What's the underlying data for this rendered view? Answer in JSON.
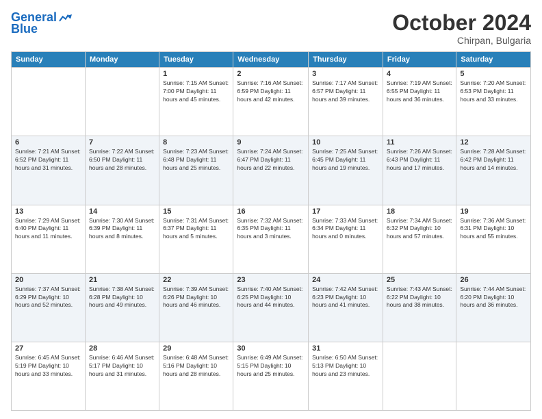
{
  "header": {
    "logo_line1": "General",
    "logo_line2": "Blue",
    "month": "October 2024",
    "location": "Chirpan, Bulgaria"
  },
  "weekdays": [
    "Sunday",
    "Monday",
    "Tuesday",
    "Wednesday",
    "Thursday",
    "Friday",
    "Saturday"
  ],
  "weeks": [
    [
      {
        "day": "",
        "info": ""
      },
      {
        "day": "",
        "info": ""
      },
      {
        "day": "1",
        "info": "Sunrise: 7:15 AM\nSunset: 7:00 PM\nDaylight: 11 hours and 45 minutes."
      },
      {
        "day": "2",
        "info": "Sunrise: 7:16 AM\nSunset: 6:59 PM\nDaylight: 11 hours and 42 minutes."
      },
      {
        "day": "3",
        "info": "Sunrise: 7:17 AM\nSunset: 6:57 PM\nDaylight: 11 hours and 39 minutes."
      },
      {
        "day": "4",
        "info": "Sunrise: 7:19 AM\nSunset: 6:55 PM\nDaylight: 11 hours and 36 minutes."
      },
      {
        "day": "5",
        "info": "Sunrise: 7:20 AM\nSunset: 6:53 PM\nDaylight: 11 hours and 33 minutes."
      }
    ],
    [
      {
        "day": "6",
        "info": "Sunrise: 7:21 AM\nSunset: 6:52 PM\nDaylight: 11 hours and 31 minutes."
      },
      {
        "day": "7",
        "info": "Sunrise: 7:22 AM\nSunset: 6:50 PM\nDaylight: 11 hours and 28 minutes."
      },
      {
        "day": "8",
        "info": "Sunrise: 7:23 AM\nSunset: 6:48 PM\nDaylight: 11 hours and 25 minutes."
      },
      {
        "day": "9",
        "info": "Sunrise: 7:24 AM\nSunset: 6:47 PM\nDaylight: 11 hours and 22 minutes."
      },
      {
        "day": "10",
        "info": "Sunrise: 7:25 AM\nSunset: 6:45 PM\nDaylight: 11 hours and 19 minutes."
      },
      {
        "day": "11",
        "info": "Sunrise: 7:26 AM\nSunset: 6:43 PM\nDaylight: 11 hours and 17 minutes."
      },
      {
        "day": "12",
        "info": "Sunrise: 7:28 AM\nSunset: 6:42 PM\nDaylight: 11 hours and 14 minutes."
      }
    ],
    [
      {
        "day": "13",
        "info": "Sunrise: 7:29 AM\nSunset: 6:40 PM\nDaylight: 11 hours and 11 minutes."
      },
      {
        "day": "14",
        "info": "Sunrise: 7:30 AM\nSunset: 6:39 PM\nDaylight: 11 hours and 8 minutes."
      },
      {
        "day": "15",
        "info": "Sunrise: 7:31 AM\nSunset: 6:37 PM\nDaylight: 11 hours and 5 minutes."
      },
      {
        "day": "16",
        "info": "Sunrise: 7:32 AM\nSunset: 6:35 PM\nDaylight: 11 hours and 3 minutes."
      },
      {
        "day": "17",
        "info": "Sunrise: 7:33 AM\nSunset: 6:34 PM\nDaylight: 11 hours and 0 minutes."
      },
      {
        "day": "18",
        "info": "Sunrise: 7:34 AM\nSunset: 6:32 PM\nDaylight: 10 hours and 57 minutes."
      },
      {
        "day": "19",
        "info": "Sunrise: 7:36 AM\nSunset: 6:31 PM\nDaylight: 10 hours and 55 minutes."
      }
    ],
    [
      {
        "day": "20",
        "info": "Sunrise: 7:37 AM\nSunset: 6:29 PM\nDaylight: 10 hours and 52 minutes."
      },
      {
        "day": "21",
        "info": "Sunrise: 7:38 AM\nSunset: 6:28 PM\nDaylight: 10 hours and 49 minutes."
      },
      {
        "day": "22",
        "info": "Sunrise: 7:39 AM\nSunset: 6:26 PM\nDaylight: 10 hours and 46 minutes."
      },
      {
        "day": "23",
        "info": "Sunrise: 7:40 AM\nSunset: 6:25 PM\nDaylight: 10 hours and 44 minutes."
      },
      {
        "day": "24",
        "info": "Sunrise: 7:42 AM\nSunset: 6:23 PM\nDaylight: 10 hours and 41 minutes."
      },
      {
        "day": "25",
        "info": "Sunrise: 7:43 AM\nSunset: 6:22 PM\nDaylight: 10 hours and 38 minutes."
      },
      {
        "day": "26",
        "info": "Sunrise: 7:44 AM\nSunset: 6:20 PM\nDaylight: 10 hours and 36 minutes."
      }
    ],
    [
      {
        "day": "27",
        "info": "Sunrise: 6:45 AM\nSunset: 5:19 PM\nDaylight: 10 hours and 33 minutes."
      },
      {
        "day": "28",
        "info": "Sunrise: 6:46 AM\nSunset: 5:17 PM\nDaylight: 10 hours and 31 minutes."
      },
      {
        "day": "29",
        "info": "Sunrise: 6:48 AM\nSunset: 5:16 PM\nDaylight: 10 hours and 28 minutes."
      },
      {
        "day": "30",
        "info": "Sunrise: 6:49 AM\nSunset: 5:15 PM\nDaylight: 10 hours and 25 minutes."
      },
      {
        "day": "31",
        "info": "Sunrise: 6:50 AM\nSunset: 5:13 PM\nDaylight: 10 hours and 23 minutes."
      },
      {
        "day": "",
        "info": ""
      },
      {
        "day": "",
        "info": ""
      }
    ]
  ]
}
